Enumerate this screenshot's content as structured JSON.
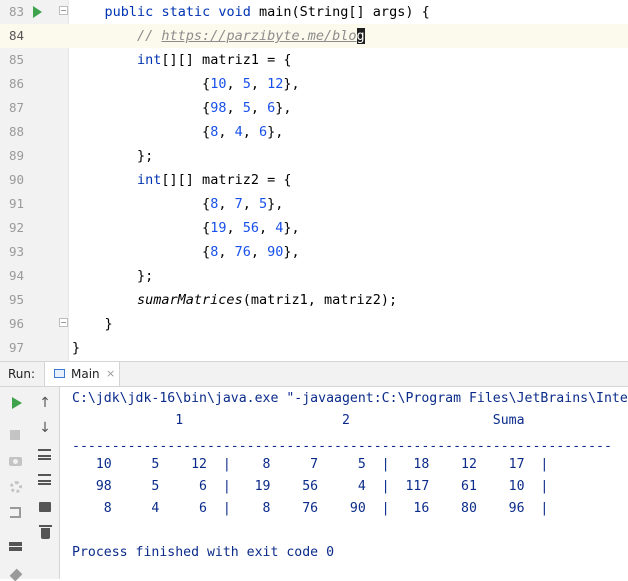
{
  "editor": {
    "lines": [
      {
        "num": "83",
        "code": [
          {
            "t": "    "
          },
          {
            "t": "public",
            "c": "kw"
          },
          {
            "t": " "
          },
          {
            "t": "static",
            "c": "kw"
          },
          {
            "t": " "
          },
          {
            "t": "void",
            "c": "kw"
          },
          {
            "t": " "
          },
          {
            "t": "main",
            "c": "plain"
          },
          {
            "t": "(String[] args) {"
          }
        ]
      },
      {
        "num": "84",
        "code": [
          {
            "t": "        "
          },
          {
            "t": "// ",
            "c": "cmt"
          },
          {
            "t": "https://parzibyte.me/blo",
            "c": "cmtlink"
          },
          {
            "t": "g",
            "c": "cursor"
          }
        ]
      },
      {
        "num": "85",
        "code": [
          {
            "t": "        "
          },
          {
            "t": "int",
            "c": "kw"
          },
          {
            "t": "[][] matriz1 = {"
          }
        ]
      },
      {
        "num": "86",
        "code": [
          {
            "t": "                "
          },
          {
            "t": "{"
          },
          {
            "t": "10",
            "c": "num"
          },
          {
            "t": ", "
          },
          {
            "t": "5",
            "c": "num"
          },
          {
            "t": ", "
          },
          {
            "t": "12",
            "c": "num"
          },
          {
            "t": "},"
          }
        ]
      },
      {
        "num": "87",
        "code": [
          {
            "t": "                "
          },
          {
            "t": "{"
          },
          {
            "t": "98",
            "c": "num"
          },
          {
            "t": ", "
          },
          {
            "t": "5",
            "c": "num"
          },
          {
            "t": ", "
          },
          {
            "t": "6",
            "c": "num"
          },
          {
            "t": "},"
          }
        ]
      },
      {
        "num": "88",
        "code": [
          {
            "t": "                "
          },
          {
            "t": "{"
          },
          {
            "t": "8",
            "c": "num"
          },
          {
            "t": ", "
          },
          {
            "t": "4",
            "c": "num"
          },
          {
            "t": ", "
          },
          {
            "t": "6",
            "c": "num"
          },
          {
            "t": "},"
          }
        ]
      },
      {
        "num": "89",
        "code": [
          {
            "t": "        "
          },
          {
            "t": "};"
          }
        ]
      },
      {
        "num": "90",
        "code": [
          {
            "t": "        "
          },
          {
            "t": "int",
            "c": "kw"
          },
          {
            "t": "[][] matriz2 = {"
          }
        ]
      },
      {
        "num": "91",
        "code": [
          {
            "t": "                "
          },
          {
            "t": "{"
          },
          {
            "t": "8",
            "c": "num"
          },
          {
            "t": ", "
          },
          {
            "t": "7",
            "c": "num"
          },
          {
            "t": ", "
          },
          {
            "t": "5",
            "c": "num"
          },
          {
            "t": "},"
          }
        ]
      },
      {
        "num": "92",
        "code": [
          {
            "t": "                "
          },
          {
            "t": "{"
          },
          {
            "t": "19",
            "c": "num"
          },
          {
            "t": ", "
          },
          {
            "t": "56",
            "c": "num"
          },
          {
            "t": ", "
          },
          {
            "t": "4",
            "c": "num"
          },
          {
            "t": "},"
          }
        ]
      },
      {
        "num": "93",
        "code": [
          {
            "t": "                "
          },
          {
            "t": "{"
          },
          {
            "t": "8",
            "c": "num"
          },
          {
            "t": ", "
          },
          {
            "t": "76",
            "c": "num"
          },
          {
            "t": ", "
          },
          {
            "t": "90",
            "c": "num"
          },
          {
            "t": "},"
          }
        ]
      },
      {
        "num": "94",
        "code": [
          {
            "t": "        "
          },
          {
            "t": "};"
          }
        ]
      },
      {
        "num": "95",
        "code": [
          {
            "t": "        "
          },
          {
            "t": "sumarMatrices",
            "c": "italic"
          },
          {
            "t": "(matriz1, matriz2);"
          }
        ]
      },
      {
        "num": "96",
        "code": [
          {
            "t": "    "
          },
          {
            "t": "}"
          }
        ]
      },
      {
        "num": "97",
        "code": [
          {
            "t": "}"
          }
        ]
      }
    ],
    "current_line_index": 1
  },
  "run_panel": {
    "label": "Run:",
    "tab_label": "Main",
    "tab_close": "×",
    "console_lines": [
      "C:\\jdk\\jdk-16\\bin\\java.exe \"-javaagent:C:\\Program Files\\JetBrains\\Inte",
      "             1                    2                  Suma",
      "",
      "--------------------------------------------------------------------",
      "   10     5    12  |    8     7     5  |   18    12    17  |",
      "   98     5     6  |   19    56     4  |  117    61    10  |",
      "    8     4     6  |    8    76    90  |   16    80    96  |",
      "",
      "Process finished with exit code 0"
    ]
  },
  "icons": {
    "run_gutter": "run-arrow-icon",
    "toolbar": [
      "rerun-icon",
      "stop-icon",
      "camera-icon",
      "settings-icon",
      "exit-icon",
      "layout-icon",
      "pin-icon",
      "up-arrow-icon",
      "down-arrow-icon",
      "soft-wrap-icon",
      "scroll-to-end-icon",
      "print-icon",
      "trash-icon"
    ]
  },
  "colors": {
    "keyword": "#0033b3",
    "number": "#1750eb",
    "comment": "#8c8c8c",
    "console_text": "#0b2b8a",
    "run_green": "#3fa34d"
  }
}
